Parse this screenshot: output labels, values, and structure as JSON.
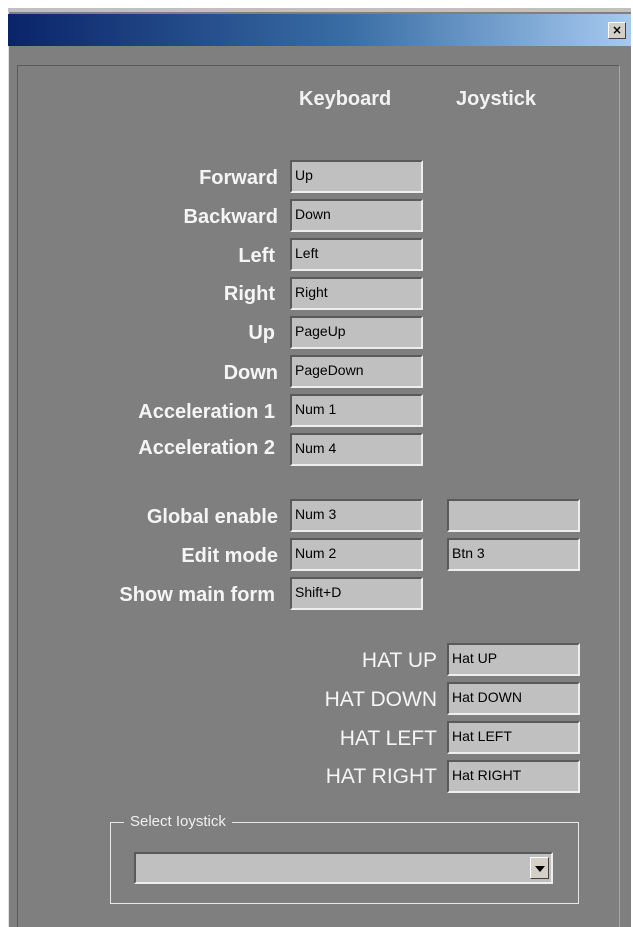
{
  "window": {
    "close_glyph": "×"
  },
  "columns": {
    "keyboard": "Keyboard",
    "joystick": "Joystick"
  },
  "bindings": [
    {
      "label": "Forward",
      "keyboard": "Up"
    },
    {
      "label": "Backward",
      "keyboard": "Down"
    },
    {
      "label": "Left",
      "keyboard": "Left"
    },
    {
      "label": "Right",
      "keyboard": "Right"
    },
    {
      "label": "Up",
      "keyboard": "PageUp"
    },
    {
      "label": "Down",
      "keyboard": "PageDown"
    },
    {
      "label": "Acceleration 1",
      "keyboard": "Num 1"
    },
    {
      "label": "Acceleration 2",
      "keyboard": "Num 4"
    }
  ],
  "controls": [
    {
      "label": "Global enable",
      "keyboard": "Num 3",
      "joystick": ""
    },
    {
      "label": "Edit mode",
      "keyboard": "Num 2",
      "joystick": "Btn 3"
    },
    {
      "label": "Show main form",
      "keyboard": "Shift+D"
    }
  ],
  "hats": [
    {
      "label": "HAT UP",
      "value": "Hat UP"
    },
    {
      "label": "HAT DOWN",
      "value": "Hat DOWN"
    },
    {
      "label": "HAT LEFT",
      "value": "Hat LEFT"
    },
    {
      "label": "HAT RIGHT",
      "value": "Hat RIGHT"
    }
  ],
  "joystick_select": {
    "title": "Select Ioystick",
    "selected": ""
  },
  "colors": {
    "face": "#7f7f7f",
    "field": "#c0c0c0",
    "title_start": "#0a246a",
    "title_end": "#a6caf0"
  }
}
